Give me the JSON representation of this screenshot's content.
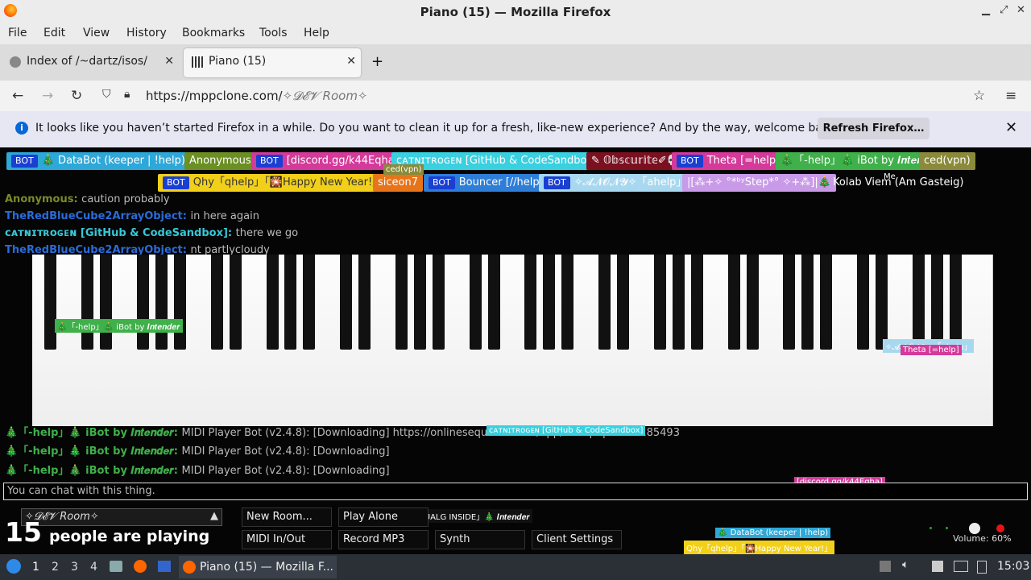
{
  "window": {
    "title": "Piano (15) — Mozilla Firefox"
  },
  "menu": [
    "File",
    "Edit",
    "View",
    "History",
    "Bookmarks",
    "Tools",
    "Help"
  ],
  "tabs": [
    {
      "label": "Index of /~dartz/isos/",
      "icon": "ftp-icon"
    },
    {
      "label": "Piano (15)",
      "icon": "piano-icon"
    }
  ],
  "url": {
    "host": "https://mppclone.com/",
    "path": "✧𝓓𝓔𝓥 Room✧"
  },
  "notification": {
    "message": "It looks like you haven’t started Firefox in a while. Do you want to clean it up for a fresh, like-new experience? And by the way, welcome back!",
    "button": "Refresh Firefox…"
  },
  "players_row1": [
    {
      "bot": "BOT",
      "name": "🎄 DataBot (keeper | !help)",
      "bg": "#2ea8d8",
      "fg": "#fff"
    },
    {
      "bot": "",
      "name": "Anonymous",
      "bg": "#6b8f22",
      "fg": "#fff"
    },
    {
      "bot": "BOT",
      "name": "[discord.gg/k44Eqha]",
      "bg": "#d43a9a",
      "fg": "#fff"
    },
    {
      "bot": "",
      "name": "ᴄᴀᴛɴɪᴛʀᴏɢᴇɴ [GitHub & CodeSandbox]",
      "bg": "#39d0e0",
      "fg": "#fff"
    },
    {
      "bot": "",
      "name": "✎ 𝕆𝕓𝕤𝕔𝕦𝕣𝕚𝕥𝕖✐💀",
      "bg": "#7a1020",
      "fg": "#fff"
    },
    {
      "bot": "BOT",
      "name": "Theta [=help]",
      "bg": "#d43a9a",
      "fg": "#fff"
    },
    {
      "bot": "",
      "name": "🎄「-help」🎄 iBot by 𝑰𝒏𝒕𝒆𝒏𝒅𝒆𝒓",
      "bg": "#3fb04a",
      "fg": "#fff"
    },
    {
      "bot": "",
      "name": "ced(vpn)",
      "bg": "#8a8a3a",
      "fg": "#fff"
    }
  ],
  "players_row2": [
    {
      "bot": "BOT",
      "name": "Qhy「qhelp」「🎇Happy New Year!」",
      "bg": "#f2d01a",
      "fg": "#333"
    },
    {
      "bot": "",
      "name": "siceon7",
      "bg": "#e8741a",
      "fg": "#fff"
    },
    {
      "bot": "BOT",
      "name": "Bouncer [//help]",
      "bg": "#2e7ed8",
      "fg": "#fff"
    },
    {
      "bot": "BOT",
      "name": "✧𝓐𝓝𝓞𝓝𝓨✧「ahelp」",
      "bg": "#a8d8f0",
      "fg": "#fff"
    },
    {
      "bot": "",
      "name": "|[⁂+✧ °*ᵇʸStep*° ✧+⁂]|🎄",
      "bg": "#c89ae8",
      "fg": "#fff"
    },
    {
      "bot": "",
      "name": "Kolab Viem (Am Gasteig)",
      "bg": "transparent",
      "fg": "#fff"
    }
  ],
  "chat": [
    {
      "name": "Anonymous:",
      "text": "caution probably",
      "color": "#7a8a2a"
    },
    {
      "name": "TheRedBlueCube2ArrayObject:",
      "text": "in here again",
      "color": "#2a6bd8"
    },
    {
      "name": "ᴄᴀᴛɴɪᴛʀᴏɢᴇɴ [GitHub & CodeSandbox]:",
      "text": "there we go",
      "color": "#37c7d7"
    },
    {
      "name": "TheRedBlueCube2ArrayObject:",
      "text": "nt partlycloudy",
      "color": "#2a6bd8"
    },
    {
      "name": "🎄「-help」🎄 iBot by 𝑰𝒏𝒕𝒆𝒏𝒅𝒆𝒓:",
      "text": "MIDI Player Bot (v2.4.8): [Downloading] https://onlinesequencer.net/app/midi.php?id=2185493",
      "color": "#3fb04a"
    },
    {
      "name": "🎄「-help」🎄 iBot by 𝑰𝒏𝒕𝒆𝒏𝒅𝒆𝒓:",
      "text": "MIDI Player Bot (v2.4.8): [Downloading]",
      "color": "#3fb04a"
    },
    {
      "name": "🎄「-help」🎄 iBot by 𝑰𝒏𝒕𝒆𝒏𝒅𝒆𝒓:",
      "text": "MIDI Player Bot (v2.4.8): [Downloading]",
      "color": "#3fb04a"
    }
  ],
  "cursor_labels": [
    {
      "text": "🎄「-help」🎄 iBot by 𝑰𝒏𝒕𝒆𝒏𝒅𝒆𝒓",
      "bg": "#3fb04a"
    },
    {
      "text": "✧𝓐𝓝𝓞𝓝𝓨✧「ahelp」",
      "bg": "#a8d8f0"
    },
    {
      "text": "Theta [=help]",
      "bg": "#d43a9a"
    },
    {
      "text": "ᴄᴀᴛɴɪᴛʀᴏɢᴇɴ [GitHub & CodeSandbox]",
      "bg": "#39d0e0"
    },
    {
      "text": "[discord.gg/k44Eqha]",
      "bg": "#d43a9a"
    },
    {
      "text": "🎄 DataBot (keeper | !help)",
      "bg": "#2ea8d8"
    },
    {
      "text": "Qhy「qhelp」「🎇Happy New Year!」",
      "bg": "#f2d01a"
    },
    {
      "text": "「GUALG INSIDE」🎄 𝑰𝒏𝒕𝒆𝒏𝒅𝒆𝒓",
      "bg": "#111"
    },
    {
      "text": "ced(vpn)",
      "bg": "#8a8a3a"
    },
    {
      "text": "Me",
      "bg": "transparent"
    }
  ],
  "chat_input": {
    "placeholder": "You can chat with this thing."
  },
  "room": {
    "name": "✧𝓓𝓔𝓥 Room✧",
    "count": "15",
    "count_label": "people are playing"
  },
  "controls": {
    "new_room": "New Room...",
    "play_alone": "Play Alone",
    "midi": "MIDI In/Out",
    "record": "Record MP3",
    "synth": "Synth",
    "client_settings": "Client Settings"
  },
  "volume": {
    "label": "Volume: 60%",
    "value": 0.6
  },
  "taskbar": {
    "workspaces": [
      "1",
      "2",
      "3",
      "4"
    ],
    "task": "Piano (15) — Mozilla F...",
    "clock": "15:03"
  },
  "colors": {
    "accent": "#0a67d6",
    "chat_bg": "#050505"
  }
}
